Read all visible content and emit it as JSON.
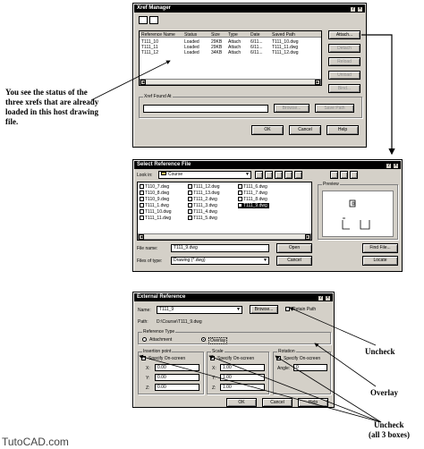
{
  "xref_manager": {
    "title": "Xref Manager",
    "columns": [
      "Reference Name",
      "Status",
      "Size",
      "Type",
      "Date",
      "Saved Path"
    ],
    "rows": [
      [
        "T111_10",
        "Loaded",
        "29KB",
        "Attach",
        "6/11...",
        "T111_10.dwg"
      ],
      [
        "T111_11",
        "Loaded",
        "29KB",
        "Attach",
        "6/11...",
        "T111_11.dwg"
      ],
      [
        "T111_12",
        "Loaded",
        "34KB",
        "Attach",
        "6/11...",
        "T111_12.dwg"
      ]
    ],
    "side_buttons": [
      "Attach...",
      "Detach",
      "Reload",
      "Unload",
      "Bind..."
    ],
    "found_at_label": "Xref Found At",
    "browse_label": "Browse...",
    "save_path_label": "Save Path",
    "ok": "OK",
    "cancel": "Cancel",
    "help": "Help"
  },
  "select_ref": {
    "title": "Select Reference File",
    "look_in_label": "Look in:",
    "look_in_value": "Course",
    "files_col1": [
      "T110_7.dwg",
      "T110_8.dwg",
      "T110_9.dwg",
      "T111_1.dwg",
      "T111_10.dwg",
      "T111_11.dwg"
    ],
    "files_col2": [
      "T111_12.dwg",
      "T111_13.dwg",
      "T111_2.dwg",
      "T111_3.dwg",
      "T111_4.dwg",
      "T111_5.dwg"
    ],
    "files_col3": [
      "T111_6.dwg",
      "T111_7.dwg",
      "T111_8.dwg",
      "T111_9.dwg"
    ],
    "preview_label": "Preview",
    "file_name_label": "File name:",
    "file_name_value": "T111_9.dwg",
    "files_type_label": "Files of type:",
    "files_type_value": "Drawing (*.dwg)",
    "open": "Open",
    "cancel": "Cancel",
    "find_file": "Find File...",
    "locate": "Locate"
  },
  "external_ref": {
    "title": "External Reference",
    "name_label": "Name:",
    "name_value": "T111_9",
    "browse": "Browse...",
    "retain_path": "Retain Path",
    "path_label": "Path:",
    "path_value": "D:\\Course\\T111_9.dwg",
    "ref_type_label": "Reference Type",
    "attachment": "Attachment",
    "overlay": "Overlay",
    "insertion_label": "Insertion point",
    "scale_label": "Scale",
    "rotation_label": "Rotation",
    "specify": "Specify On-screen",
    "x": "X:",
    "y": "Y:",
    "z": "Z:",
    "ins_x": "0.00",
    "ins_y": "0.00",
    "ins_z": "0.00",
    "sc_x": "1.00",
    "sc_y": "1.00",
    "sc_z": "1.00",
    "angle_label": "Angle:",
    "angle_value": "0",
    "ok": "OK",
    "cancel": "Cancel",
    "help": "Help"
  },
  "annotations": {
    "status_note": "You see the status of the three xrefs that are already loaded in this host drawing file.",
    "uncheck": "Uncheck",
    "overlay": "Overlay",
    "uncheck_all": "Uncheck",
    "uncheck_all_sub": "(all 3 boxes)"
  },
  "watermark": "TutoCAD.com"
}
